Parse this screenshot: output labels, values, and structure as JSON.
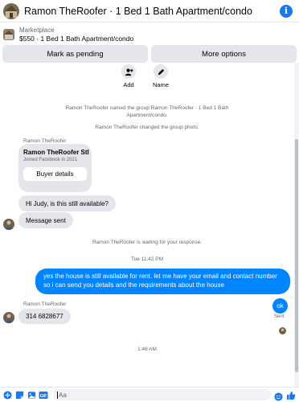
{
  "header": {
    "title": "Ramon TheRoofer · 1 Bed 1 Bath Apartment/condo",
    "info_icon": "info-icon",
    "info_glyph": "i"
  },
  "listing": {
    "source": "Marketplace",
    "item": "$550 · 1 Bed 1 Bath Apartment/condo"
  },
  "actions": {
    "mark_pending": "Mark as pending",
    "more_options": "More options"
  },
  "quick_actions": [
    {
      "label": "Add",
      "icon": "add-person-icon"
    },
    {
      "label": "Name",
      "icon": "pencil-icon"
    }
  ],
  "system_messages": {
    "named_group": "Ramon TheRoofer named the group Ramon TheRoofer · 1 Bed 1 Bath Apartment/condo.",
    "changed_photo": "Ramon TheRoofer changed the group photo.",
    "waiting": "Ramon TheRoofer is waiting for your response."
  },
  "thread": {
    "sender_name_1": "Ramon TheRoofer",
    "profile_card": {
      "name": "Ramon TheRoofer Stl",
      "subtitle": "Joined Facebook in 2021",
      "button": "Buyer details"
    },
    "msg_incoming_1": "Hi Judy, is this still available?",
    "msg_incoming_2": "Message sent",
    "timestamp_1": "Tue 11:42 PM",
    "msg_outgoing_1": "yes the house is still available for rent. let me have your email  and contact number so i can send you details and the requirements about the house",
    "sender_name_2": "Ramon TheRoofer",
    "msg_incoming_3": "314 6828677",
    "timestamp_2": "1:48 AM",
    "msg_outgoing_2": "ok",
    "sent_status": "Sent"
  },
  "composer": {
    "placeholder": "Aa",
    "icons": [
      "plus-icon",
      "sticker-icon",
      "gallery-icon",
      "gif-icon",
      "emoji-icon",
      "thumbs-up-icon"
    ],
    "gif_label": "GIF"
  },
  "colors": {
    "accent": "#1877f2",
    "outgoing_bubble": "#0084ff",
    "incoming_bubble": "#e4e6eb",
    "secondary_text": "#65676b"
  }
}
